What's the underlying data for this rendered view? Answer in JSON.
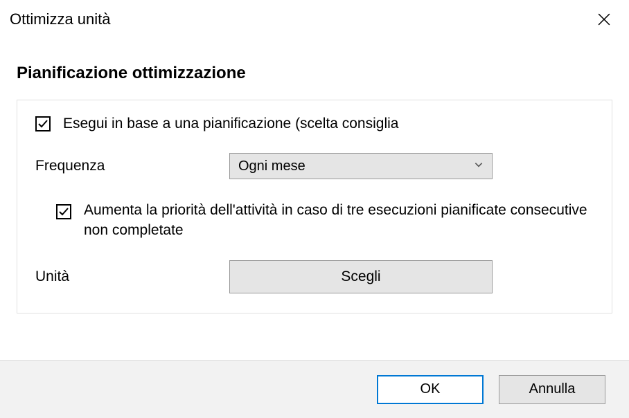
{
  "window": {
    "title": "Ottimizza unità"
  },
  "section": {
    "heading": "Pianificazione ottimizzazione"
  },
  "schedule": {
    "runOnScheduleLabel": "Esegui in base a una pianificazione (scelta consiglia",
    "frequencyLabel": "Frequenza",
    "frequencyValue": "Ogni mese",
    "increasePriorityLabel": "Aumenta la priorità dell'attività in caso di tre esecuzioni pianificate consecutive non completate",
    "unitLabel": "Unità",
    "chooseButton": "Scegli"
  },
  "footer": {
    "okLabel": "OK",
    "cancelLabel": "Annulla"
  }
}
